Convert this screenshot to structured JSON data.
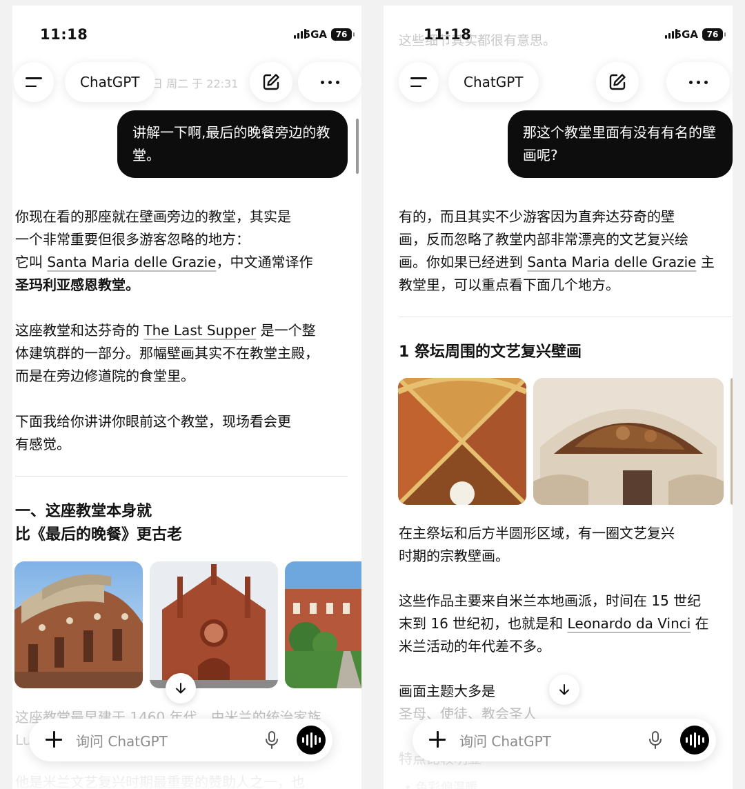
{
  "status": {
    "time": "11:18",
    "network": "5GA",
    "battery": "76"
  },
  "app": {
    "title": "ChatGPT",
    "composer_placeholder": "询问 ChatGPT"
  },
  "left": {
    "ghost_text": "日 周二 于 22:31",
    "user_message": "讲解一下啊,最后的晚餐旁边的教堂。",
    "p1_line1": "你现在看的那座就在壁画旁边的教堂，其实是",
    "p1_line2": "一个非常重要但很多游客忽略的地方：",
    "p1_line3_pre": "它叫 ",
    "p1_term": "Santa Maria delle Grazie",
    "p1_line3_post": "，中文通常译作",
    "p1_bold": "圣玛利亚感恩教堂",
    "p1_bold_end": "。",
    "p2_pre": "这座教堂和达芬奇的 ",
    "p2_term": "The Last Supper",
    "p2_post": " 是一个整",
    "p2_line2": "体建筑群的一部分。那幅壁画其实不在教堂主殿，",
    "p2_line3": "而是在旁边修道院的食堂里。",
    "p3_line1": "下面我给你讲讲你眼前这个教堂，现场看会更",
    "p3_line2": "有感觉。",
    "heading_line1": "一、这座教堂本身就",
    "heading_line2": "比《最后的晚餐》更古老",
    "faded_1": "这座教堂最早建于 1460 年代，由米兰的统治家族",
    "faded_2": "Lu",
    "faded_3": "他是米兰文艺复兴时期最重要的赞助人之一，也"
  },
  "right": {
    "ghost_text": "这些细节其实都很有意思。",
    "user_message": "那这个教堂里面有没有有名的壁画呢?",
    "p1_line1": "有的，而且其实不少游客因为直奔达芬奇的壁",
    "p1_line2": "画，反而忽略了教堂内部非常漂亮的文艺复兴绘",
    "p1_line3_pre": "画。你如果已经进到 ",
    "p1_term": "Santa Maria delle Grazie",
    "p1_line3_post": " 主",
    "p1_line4": "教堂里，可以重点看下面几个地方。",
    "heading": "1 祭坛周围的文艺复兴壁画",
    "p2_line1": "在主祭坛和后方半圆形区域，有一圈文艺复兴",
    "p2_line2": "时期的宗教壁画。",
    "p3_line1": "这些作品主要来自米兰本地画派，时间在 15 世纪",
    "p3_line2_pre": "末到 16 世纪初，也就是和 ",
    "p3_term": "Leonardo da Vinci",
    "p3_line2_post": " 在",
    "p3_line3": "米兰活动的年代差不多。",
    "p4_line1": "画面主题大多是",
    "faded_1": "圣母、使徒、教会圣人",
    "faded_2": "特点比较明显",
    "faded_3": "• 色彩偏温暖"
  },
  "colors": {
    "bubble": "#0d0d0d",
    "page": "#ffffff",
    "gap": "#f2f2f2"
  },
  "icons": [
    "menu-icon",
    "edit-icon",
    "more-icon",
    "arrow-down-icon",
    "plus-icon",
    "microphone-icon",
    "voice-mode-icon"
  ]
}
